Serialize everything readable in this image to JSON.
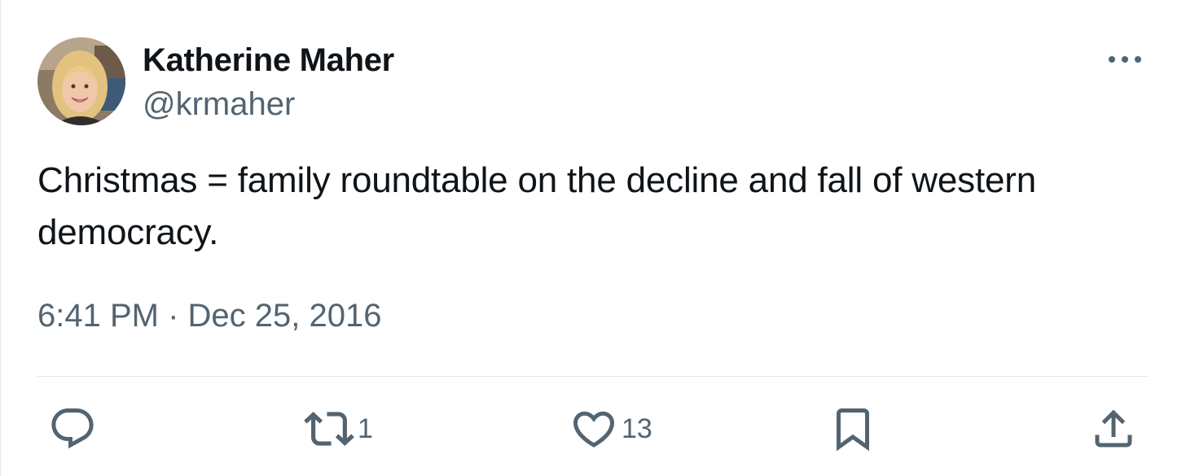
{
  "author": {
    "display_name": "Katherine Maher",
    "handle": "@krmaher"
  },
  "tweet": {
    "text_line1": "Christmas = family roundtable on the decline and fall of western",
    "text_line2": "democracy.",
    "timestamp": "6:41 PM · Dec 25, 2016"
  },
  "actions": {
    "reply_icon": "reply-icon",
    "retweet_icon": "retweet-icon",
    "retweet_count": "1",
    "like_icon": "heart-icon",
    "like_count": "13",
    "bookmark_icon": "bookmark-icon",
    "share_icon": "share-icon"
  },
  "menu": {
    "icon": "more-icon"
  },
  "colors": {
    "text_primary": "#0f1419",
    "text_secondary": "#536471",
    "divider": "#e3e7ea"
  }
}
